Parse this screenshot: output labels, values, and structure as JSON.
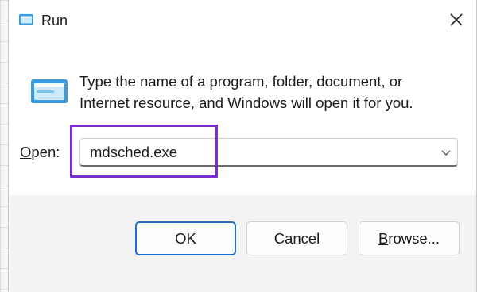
{
  "window": {
    "title": "Run",
    "close_icon": "close-icon",
    "app_icon": "run-app-icon"
  },
  "main": {
    "icon": "run-program-icon",
    "message": "Type the name of a program, folder, document, or Internet resource, and Windows will open it for you.",
    "open_label_access_key": "O",
    "open_label_rest": "pen:",
    "open_value": "mdsched.exe",
    "dropdown_icon": "chevron-down-icon"
  },
  "annotation": {
    "highlight_color": "#7b2fd1"
  },
  "buttons": {
    "ok": "OK",
    "cancel": "Cancel",
    "browse_access_key": "B",
    "browse_rest": "rowse..."
  },
  "colors": {
    "accent": "#1f6fc4",
    "icon_blue": "#3a9be0"
  }
}
